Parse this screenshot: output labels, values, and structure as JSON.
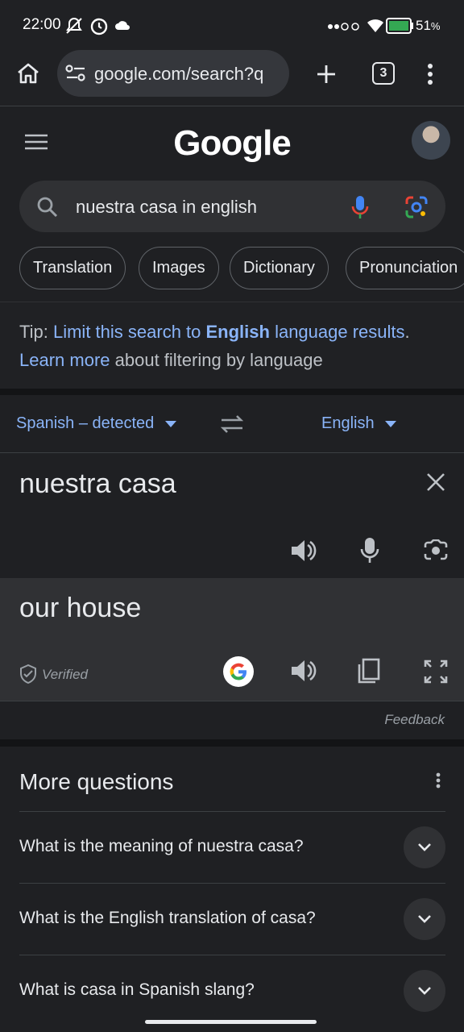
{
  "status": {
    "time": "22:00",
    "battery": "51",
    "battery_unit": "%"
  },
  "browser": {
    "url": "google.com/search?q",
    "tab_count": "3"
  },
  "google": {
    "logo": "Google",
    "query": "nuestra casa in english"
  },
  "chips": [
    "Translation",
    "Images",
    "Dictionary",
    "Pronunciation"
  ],
  "tip": {
    "prefix": "Tip: ",
    "link_a": "Limit this search to ",
    "link_bold": "English",
    "link_b": " language results",
    "period": ".",
    "learn_more": "Learn more",
    "rest": " about filtering by language"
  },
  "translate": {
    "source_lang": "Spanish – detected",
    "target_lang": "English",
    "source_text": "nuestra casa",
    "target_text": "our house",
    "verified": "Verified",
    "feedback": "Feedback"
  },
  "more_questions": {
    "title": "More questions",
    "items": [
      "What is the meaning of nuestra casa?",
      "What is the English translation of casa?",
      "What is casa in Spanish slang?"
    ]
  },
  "colors": {
    "link": "#8ab4f8",
    "background": "#1f2023",
    "target_panel": "#303134"
  }
}
